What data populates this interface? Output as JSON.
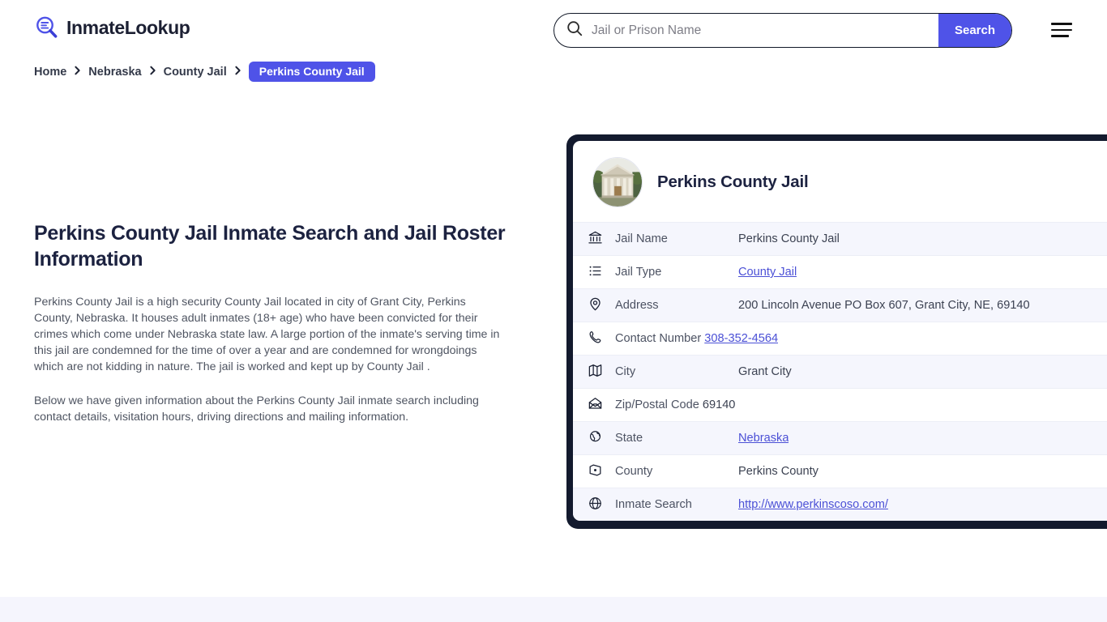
{
  "header": {
    "logo_text": "InmateLookup",
    "logo_icon": "magnifier-list-icon",
    "menu_icon": "hamburger-menu-icon"
  },
  "search": {
    "icon": "search-icon",
    "placeholder": "Jail or Prison Name",
    "value": "",
    "button_label": "Search"
  },
  "breadcrumb": {
    "items": [
      {
        "label": "Home",
        "active": false
      },
      {
        "label": "Nebraska",
        "active": false
      },
      {
        "label": "County Jail",
        "active": false
      },
      {
        "label": "Perkins County Jail",
        "active": true
      }
    ],
    "separator_icon": "chevron-right-icon"
  },
  "main": {
    "title": "Perkins County Jail Inmate Search and Jail Roster Information",
    "paragraph_1": "Perkins County Jail is a high security County Jail located in city of Grant City, Perkins County, Nebraska. It houses adult inmates (18+ age) who have been convicted for their crimes which come under Nebraska state law. A large portion of the inmate's serving time in this jail are condemned for the time of over a year and are condemned for wrongdoings which are not kidding in nature. The jail is worked and kept up by County Jail .",
    "paragraph_2": "Below we have given information about the Perkins County Jail inmate search including contact details, visitation hours, driving directions and mailing information."
  },
  "card": {
    "avatar_icon": "courthouse-photo",
    "title": "Perkins County Jail",
    "rows": [
      {
        "icon": "bank-icon",
        "label": "Jail Name",
        "value": "Perkins County Jail",
        "link": false
      },
      {
        "icon": "list-icon",
        "label": "Jail Type",
        "value": "County Jail",
        "link": true
      },
      {
        "icon": "map-pin-icon",
        "label": "Address",
        "value": "200 Lincoln Avenue PO Box 607, Grant City, NE, 69140",
        "link": false
      },
      {
        "icon": "phone-icon",
        "label": "Contact Number",
        "value": "308-352-4564",
        "link": true
      },
      {
        "icon": "map-icon",
        "label": "City",
        "value": "Grant City",
        "link": false
      },
      {
        "icon": "envelope-icon",
        "label": "Zip/Postal Code",
        "value": "69140",
        "link": false
      },
      {
        "icon": "globe-pin-icon",
        "label": "State",
        "value": "Nebraska",
        "link": true
      },
      {
        "icon": "map-marker-icon",
        "label": "County",
        "value": "Perkins County",
        "link": false
      },
      {
        "icon": "globe-icon",
        "label": "Inmate Search",
        "value": "http://www.perkinscoso.com/",
        "link": true
      }
    ]
  },
  "colors": {
    "accent": "#4f53e8",
    "card_border": "#131a2e",
    "row_alt": "#f5f6fd",
    "link": "#4b50d6",
    "title": "#1c2240",
    "body_text": "#4f5562",
    "footer_strip": "#f5f5fd"
  }
}
